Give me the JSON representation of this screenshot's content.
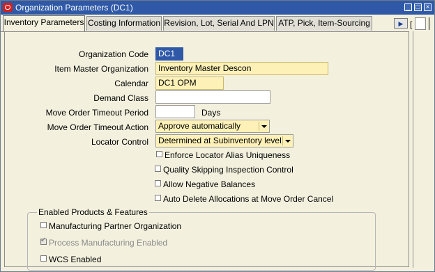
{
  "window": {
    "title": "Organization Parameters (DC1)"
  },
  "tabs": [
    {
      "label": "Inventory Parameters",
      "active": true
    },
    {
      "label": "Costing Information",
      "active": false
    },
    {
      "label": "Revision, Lot, Serial And LPN",
      "active": false
    },
    {
      "label": "ATP, Pick, Item-Sourcing",
      "active": false
    }
  ],
  "tab_scroll_glyph": "▶",
  "tab_bracket": "[",
  "form": {
    "org_code_label": "Organization Code",
    "org_code_value": "DC1",
    "item_master_label": "Item Master Organization",
    "item_master_value": "Inventory Master Descon",
    "calendar_label": "Calendar",
    "calendar_value": "DC1 OPM",
    "demand_class_label": "Demand Class",
    "demand_class_value": "",
    "timeout_period_label": "Move Order Timeout Period",
    "timeout_period_value": "",
    "timeout_period_unit": "Days",
    "timeout_action_label": "Move Order Timeout Action",
    "timeout_action_value": "Approve automatically",
    "locator_control_label": "Locator Control",
    "locator_control_value": "Determined at Subinventory level"
  },
  "checkboxes": [
    {
      "label": "Enforce Locator Alias Uniqueness",
      "checked": false,
      "disabled": false
    },
    {
      "label": "Quality Skipping Inspection Control",
      "checked": false,
      "disabled": false
    },
    {
      "label": "Allow Negative Balances",
      "checked": false,
      "disabled": false
    },
    {
      "label": "Auto Delete Allocations at Move Order Cancel",
      "checked": false,
      "disabled": false
    }
  ],
  "products_group": {
    "title": "Enabled Products & Features",
    "items": [
      {
        "label": "Manufacturing Partner Organization",
        "checked": false,
        "disabled": false
      },
      {
        "label": "Process Manufacturing Enabled",
        "checked": true,
        "disabled": true
      },
      {
        "label": "WCS Enabled",
        "checked": false,
        "disabled": false
      }
    ]
  },
  "colors": {
    "titlebar": "#2f59a7",
    "required_field": "#fdf1b8",
    "canvas": "#f3f1de"
  }
}
